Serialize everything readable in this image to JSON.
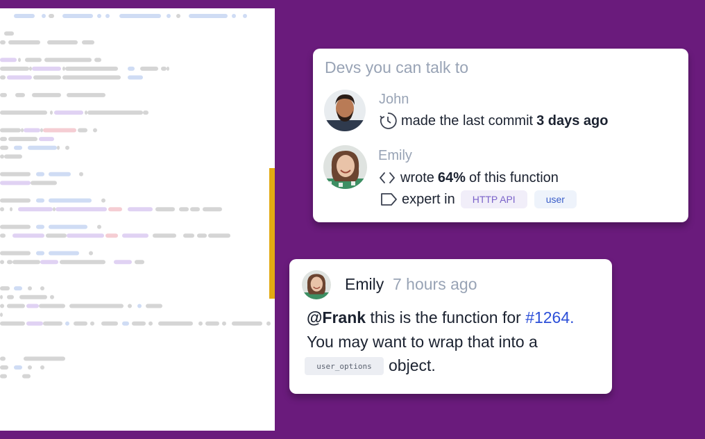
{
  "devs_panel": {
    "title": "Devs you can talk to",
    "developers": [
      {
        "name": "John",
        "activity_prefix": "made the last commit",
        "activity_highlight": "3 days ago",
        "activity_suffix": "",
        "icon": "clock-icon"
      },
      {
        "name": "Emily",
        "activity_prefix": "wrote",
        "activity_highlight": "64%",
        "activity_suffix": "of this function",
        "icon": "code-brackets-icon",
        "expertise_label": "expert in",
        "expertise_icon": "tag-icon",
        "tags": [
          "HTTP API",
          "user"
        ]
      }
    ]
  },
  "comment": {
    "author": "Emily",
    "time": "7 hours ago",
    "mention": "@Frank",
    "line1_text": "this is the function for",
    "issue_link": "#1264.",
    "line2_text": "You may want to wrap that into a",
    "code_chip": "user_options",
    "line3_suffix": "object."
  },
  "colors": {
    "background": "#6a1b7c",
    "scroll_marker": "#e3a911",
    "link": "#2c4fd8"
  }
}
